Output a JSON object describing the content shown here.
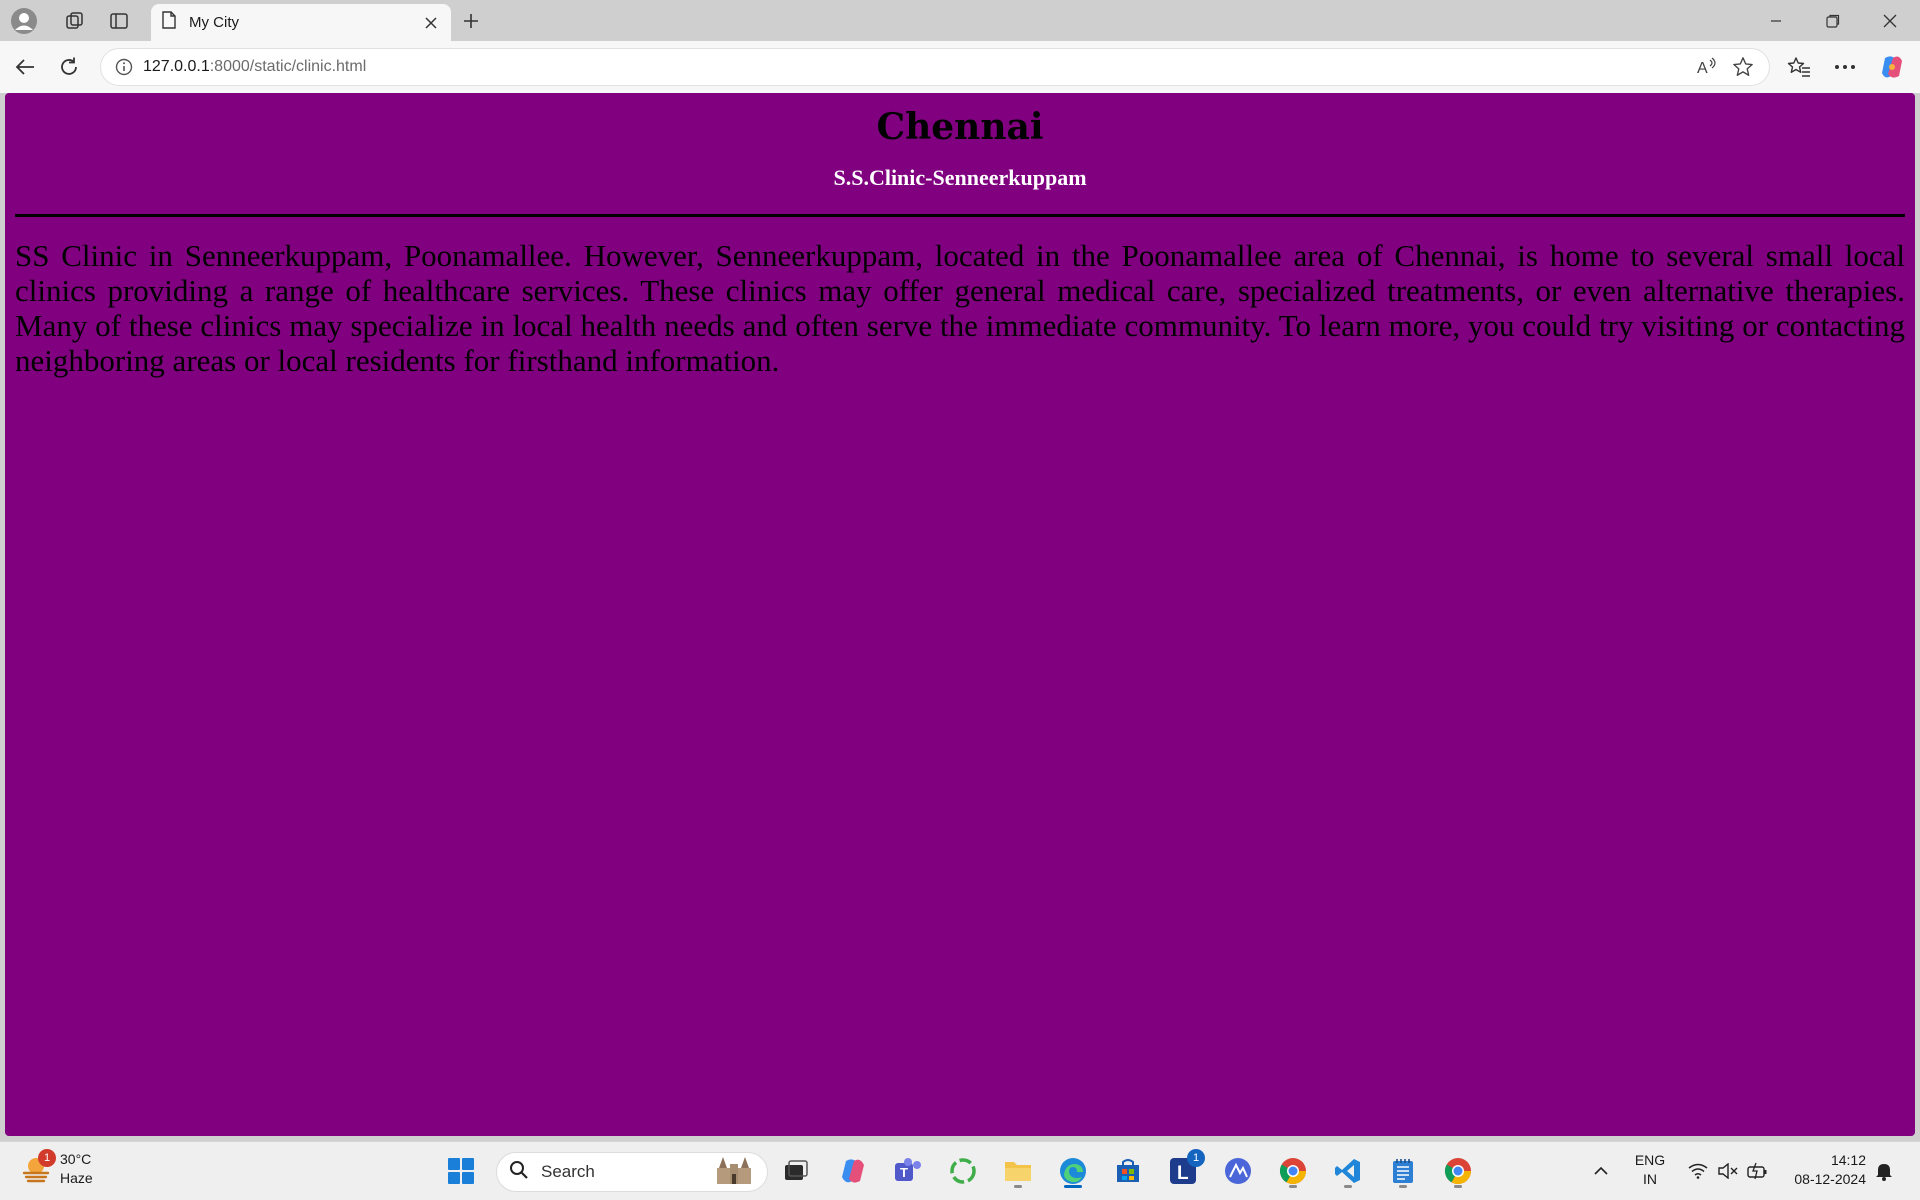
{
  "browser": {
    "tab_title": "My City",
    "url_host": "127.0.0.1",
    "url_path": ":8000/static/clinic.html"
  },
  "page": {
    "heading": "Chennai",
    "subheading": "S.S.Clinic-Senneerkuppam",
    "paragraph": "SS Clinic in Senneerkuppam, Poonamallee. However, Senneerkuppam, located in the Poonamallee area of Chennai, is home to several small local clinics providing a range of healthcare services. These clinics may offer general medical care, specialized treatments, or even alternative therapies. Many of these clinics may specialize in local health needs and often serve the immediate community. To learn more, you could try visiting or contacting neighboring areas or local residents for firsthand information.",
    "background_color": "#800080"
  },
  "taskbar": {
    "weather_temp": "30°C",
    "weather_desc": "Haze",
    "weather_badge": "1",
    "search_label": "Search",
    "lang_line1": "ENG",
    "lang_line2": "IN",
    "time": "14:12",
    "date": "08-12-2024",
    "launcher_badge": "1"
  }
}
